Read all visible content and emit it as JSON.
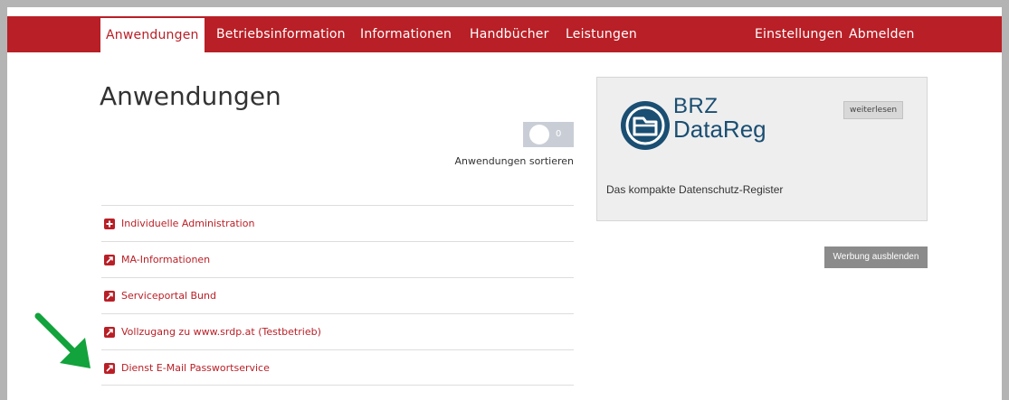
{
  "nav": {
    "left": [
      {
        "label": "Anwendungen",
        "active": true
      },
      {
        "label": "Betriebsinformation"
      },
      {
        "label": "Informationen"
      },
      {
        "label": "Handbücher"
      },
      {
        "label": "Leistungen"
      }
    ],
    "right": [
      {
        "label": "Einstellungen"
      },
      {
        "label": "Abmelden"
      }
    ]
  },
  "main": {
    "title": "Anwendungen",
    "toggle": {
      "state_text": "0",
      "label": "Anwendungen sortieren"
    },
    "apps": [
      {
        "label": "Individuelle Administration",
        "icon": "plus-square-icon"
      },
      {
        "label": "MA-Informationen",
        "icon": "external-link-icon"
      },
      {
        "label": "Serviceportal Bund",
        "icon": "external-link-icon"
      },
      {
        "label": "Vollzugang zu www.srdp.at (Testbetrieb)",
        "icon": "external-link-icon"
      },
      {
        "label": "Dienst E-Mail Passwortservice",
        "icon": "external-link-icon"
      }
    ]
  },
  "ad": {
    "brand_line1": "BRZ",
    "brand_line2": "DataReg",
    "read_more": "weiterlesen",
    "tagline": "Das kompakte Datenschutz-Register",
    "hide_button": "Werbung ausblenden"
  },
  "colors": {
    "brand_red": "#b91f26",
    "logo_blue": "#1a4e72",
    "arrow_green": "#12a33c"
  }
}
